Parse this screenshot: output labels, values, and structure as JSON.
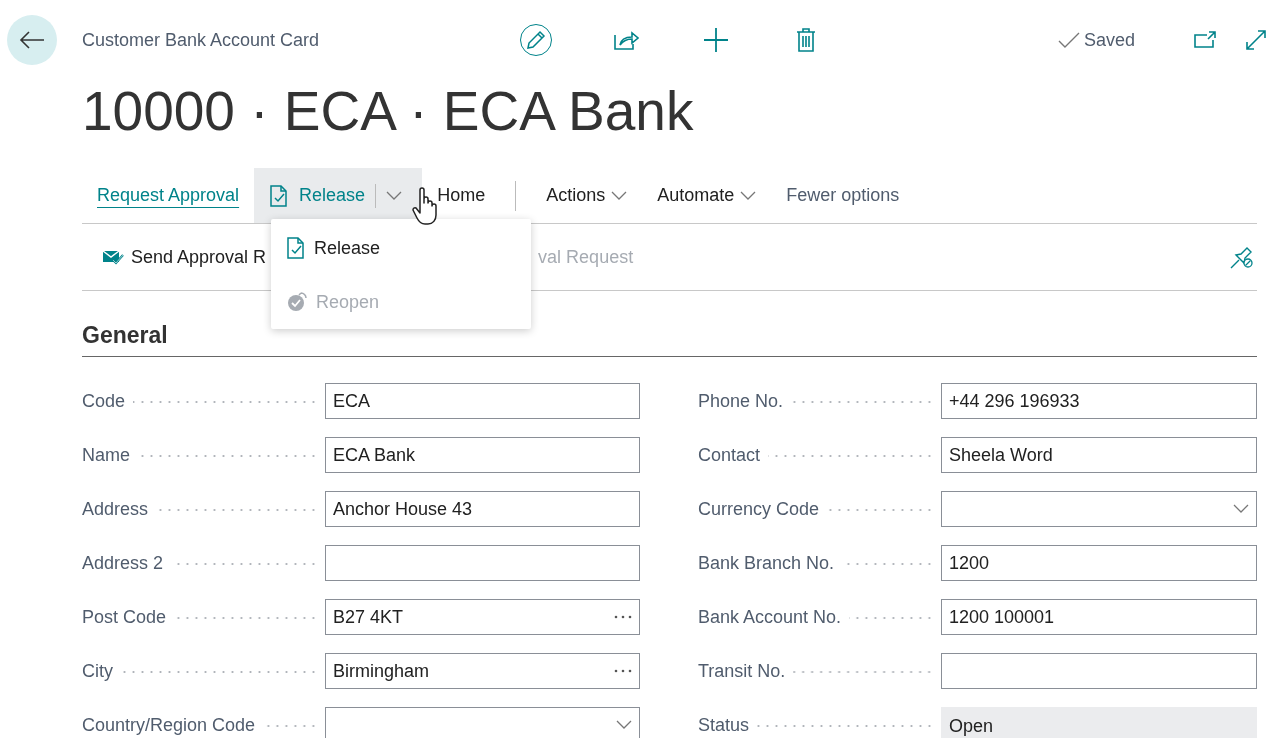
{
  "header": {
    "breadcrumb": "Customer Bank Account Card",
    "status": "Saved"
  },
  "title": "10000 · ECA · ECA Bank",
  "action_tabs": [
    {
      "label": "Request Approval",
      "kind": "tab",
      "selected": true
    },
    {
      "label": "Release",
      "kind": "split",
      "selected": false,
      "expanded": true
    },
    {
      "label": "Home",
      "kind": "tab",
      "selected": false
    },
    {
      "label": "Actions",
      "kind": "menu",
      "selected": false
    },
    {
      "label": "Automate",
      "kind": "menu",
      "selected": false
    },
    {
      "label": "Fewer options",
      "kind": "link",
      "selected": false
    }
  ],
  "release_menu": [
    {
      "label": "Release",
      "kind": "release",
      "disabled": false
    },
    {
      "label": "Reopen",
      "kind": "reopen",
      "disabled": true
    }
  ],
  "action_row": [
    {
      "label": "Send Approval R",
      "kind": "send",
      "disabled": false
    },
    {
      "label": "val Request",
      "kind": "plain",
      "disabled": true
    }
  ],
  "section": {
    "title": "General"
  },
  "fields_left": [
    {
      "label": "Code",
      "value": "ECA",
      "kind": "text"
    },
    {
      "label": "Name",
      "value": "ECA Bank",
      "kind": "text"
    },
    {
      "label": "Address",
      "value": "Anchor House 43",
      "kind": "text"
    },
    {
      "label": "Address 2",
      "kind": "text"
    },
    {
      "label": "Post Code",
      "value": "B27 4KT",
      "kind": "lookup"
    },
    {
      "label": "City",
      "value": "Birmingham",
      "kind": "lookup"
    },
    {
      "label": "Country/Region Code",
      "kind": "dropdown"
    }
  ],
  "fields_right": [
    {
      "label": "Phone No.",
      "value": "+44 296 196933",
      "kind": "text"
    },
    {
      "label": "Contact",
      "value": "Sheela Word",
      "kind": "text"
    },
    {
      "label": "Currency Code",
      "kind": "dropdown"
    },
    {
      "label": "Bank Branch No.",
      "value": "1200",
      "kind": "text"
    },
    {
      "label": "Bank Account No.",
      "value": "1200 100001",
      "kind": "text"
    },
    {
      "label": "Transit No.",
      "kind": "text"
    },
    {
      "label": "Status",
      "value": "Open",
      "kind": "readonly"
    }
  ]
}
